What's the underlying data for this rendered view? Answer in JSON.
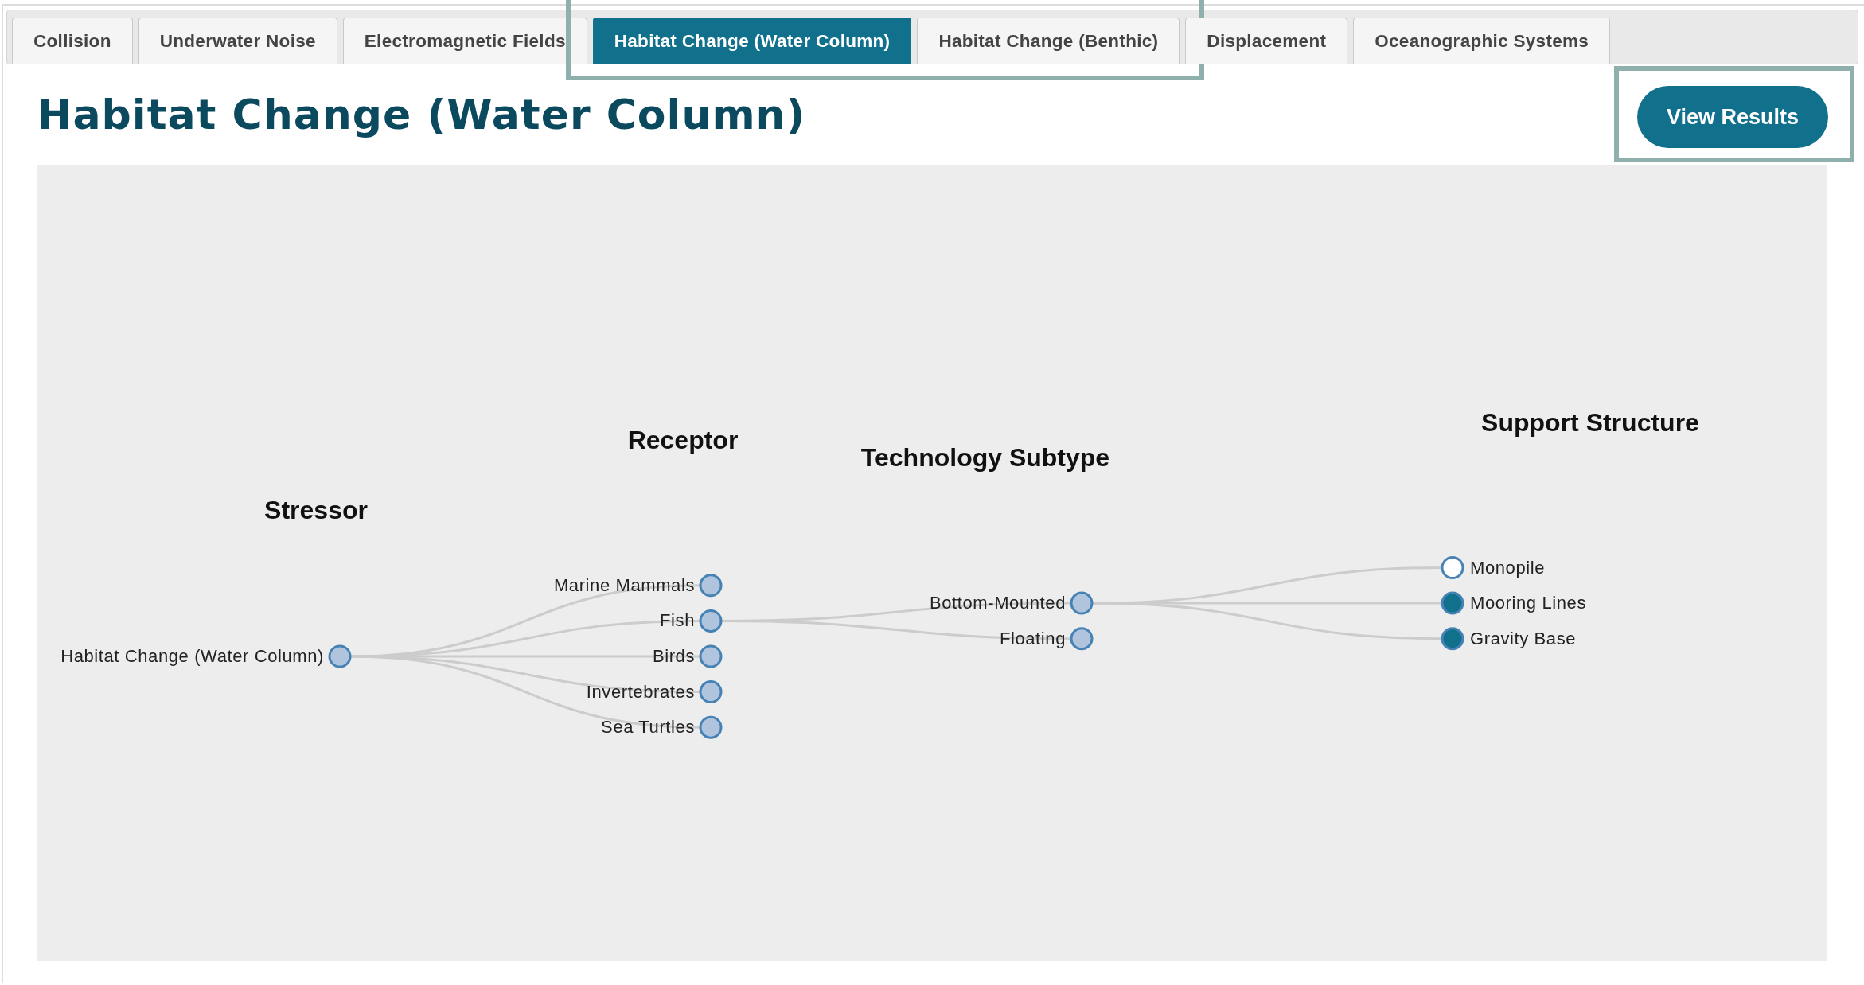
{
  "tabs": [
    {
      "label": "Collision",
      "selected": false,
      "highlighted": false
    },
    {
      "label": "Underwater Noise",
      "selected": false,
      "highlighted": false
    },
    {
      "label": "Electromagnetic Fields",
      "selected": false,
      "highlighted": false
    },
    {
      "label": "Habitat Change (Water Column)",
      "selected": true,
      "highlighted": true
    },
    {
      "label": "Habitat Change (Benthic)",
      "selected": false,
      "highlighted": false
    },
    {
      "label": "Displacement",
      "selected": false,
      "highlighted": false
    },
    {
      "label": "Oceanographic Systems",
      "selected": false,
      "highlighted": false
    }
  ],
  "heading": "Habitat Change (Water Column)",
  "view_results_button": {
    "label": "View Results",
    "highlighted": true
  },
  "tree": {
    "levels": [
      "Stressor",
      "Receptor",
      "Technology Subtype",
      "Support Structure"
    ],
    "root": {
      "label": "Habitat Change (Water Column)",
      "children": [
        {
          "label": "Marine Mammals",
          "collapsed": true
        },
        {
          "label": "Fish",
          "children": [
            {
              "label": "Bottom-Mounted",
              "children": [
                {
                  "label": "Monopile",
                  "collapsed": false,
                  "selected": false
                },
                {
                  "label": "Mooring Lines",
                  "collapsed": false,
                  "selected": true
                },
                {
                  "label": "Gravity Base",
                  "collapsed": false,
                  "selected": true
                }
              ]
            },
            {
              "label": "Floating",
              "collapsed": true
            }
          ]
        },
        {
          "label": "Birds",
          "collapsed": true
        },
        {
          "label": "Invertebrates",
          "collapsed": true
        },
        {
          "label": "Sea Turtles",
          "collapsed": true
        }
      ]
    }
  }
}
